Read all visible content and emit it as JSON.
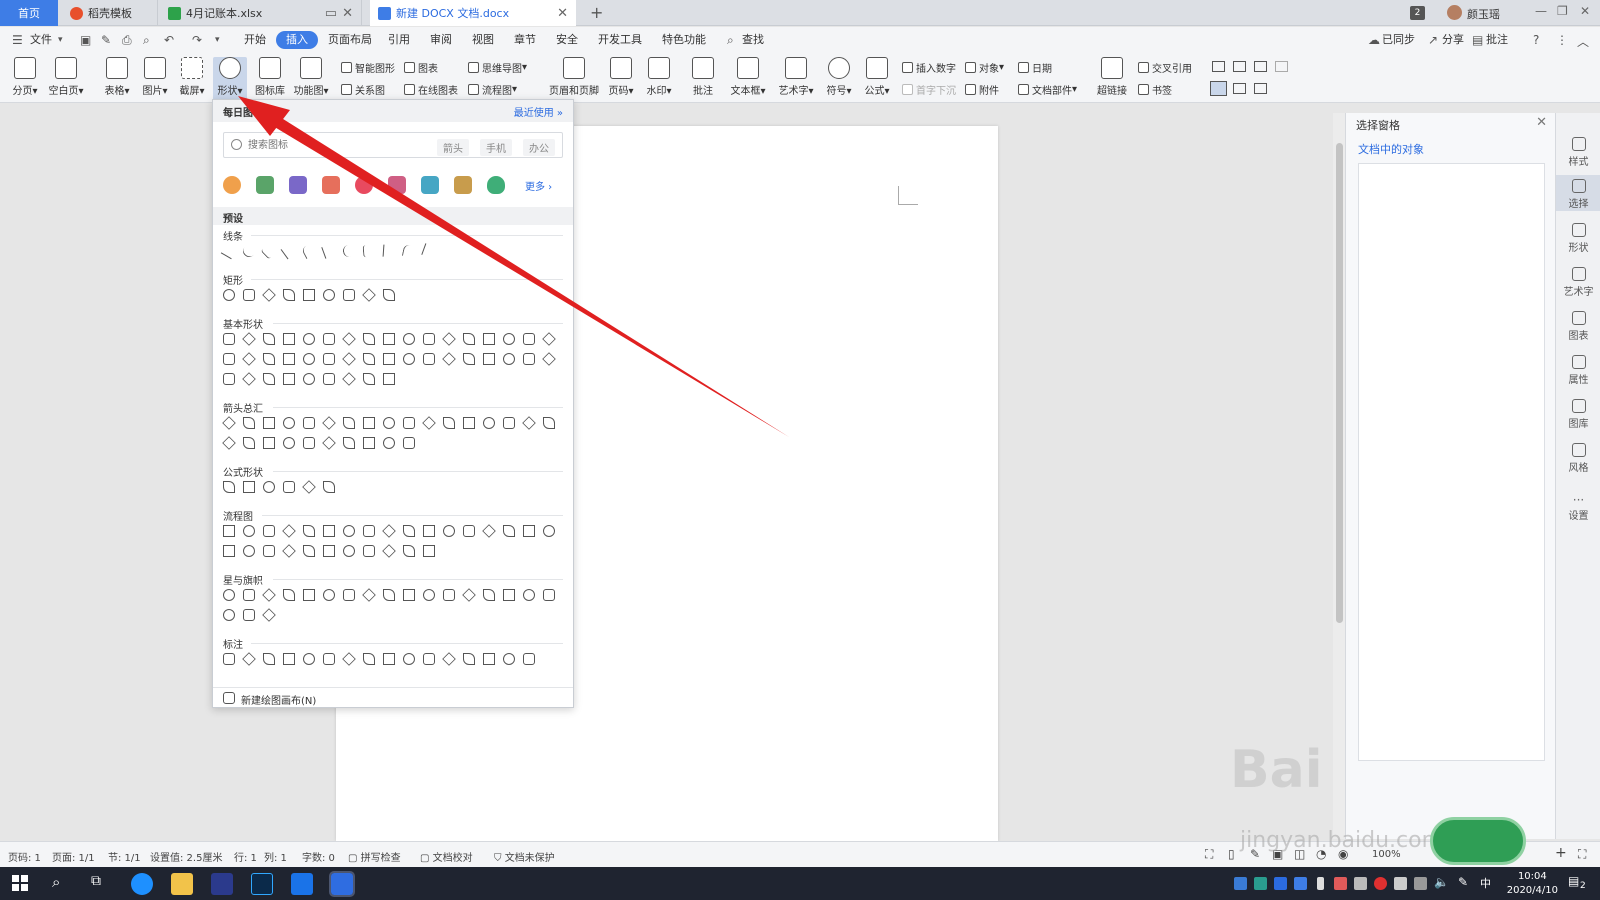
{
  "tabs": [
    {
      "label": "首页",
      "state": "home"
    },
    {
      "label": "稻壳模板",
      "state": "inactive"
    },
    {
      "label": "4月记账本.xlsx",
      "state": "inactive"
    },
    {
      "label": "新建 DOCX 文档.docx",
      "state": "active"
    }
  ],
  "tab_badge": "2",
  "user_name": "颜玉瑶",
  "menus": [
    "开始",
    "插入",
    "页面布局",
    "引用",
    "审阅",
    "视图",
    "章节",
    "安全",
    "开发工具",
    "特色功能"
  ],
  "menu_active": "插入",
  "file_menu": "文件",
  "search_label": "查找",
  "top_right": {
    "sync": "已同步",
    "share": "分享",
    "comment": "批注"
  },
  "ribbon": {
    "page_break": "分页",
    "blank_page": "空白页",
    "table": "表格",
    "picture": "图片",
    "screenshot": "截屏",
    "shapes": "形状",
    "icon_lib": "图标库",
    "function_chart": "功能图",
    "smart_art": "智能图形",
    "chart": "图表",
    "relation": "关系图",
    "online_chart": "在线图表",
    "mind_map": "思维导图",
    "flowchart": "流程图",
    "header_footer": "页眉和页脚",
    "page_number": "页码",
    "watermark": "水印",
    "comment": "批注",
    "textbox": "文本框",
    "wordart": "艺术字",
    "symbol": "符号",
    "formula": "公式",
    "insert_number": "插入数字",
    "object": "对象",
    "date": "日期",
    "drop_cap": "首字下沉",
    "attachment": "附件",
    "doc_parts": "文档部件",
    "hyperlink": "超链接",
    "cross_ref": "交叉引用",
    "bookmark": "书签"
  },
  "dropdown": {
    "header_left": "每日图标",
    "header_right": "最近使用",
    "search_placeholder": "搜索图标",
    "chips": [
      "箭头",
      "手机",
      "办公"
    ],
    "more": "更多",
    "preset": "预设",
    "categories": [
      {
        "name": "线条",
        "rows": [
          11
        ]
      },
      {
        "name": "矩形",
        "rows": [
          9
        ]
      },
      {
        "name": "基本形状",
        "rows": [
          17,
          17,
          9
        ]
      },
      {
        "name": "箭头总汇",
        "rows": [
          17,
          10
        ]
      },
      {
        "name": "公式形状",
        "rows": [
          6
        ]
      },
      {
        "name": "流程图",
        "rows": [
          17,
          11
        ]
      },
      {
        "name": "星与旗帜",
        "rows": [
          17,
          3
        ]
      },
      {
        "name": "标注",
        "rows": [
          16
        ]
      }
    ],
    "footer": "新建绘图画布(N)"
  },
  "selection_pane": {
    "title": "选择窗格",
    "subtitle": "文档中的对象"
  },
  "sidebar": [
    {
      "label": "样式"
    },
    {
      "label": "选择"
    },
    {
      "label": "形状"
    },
    {
      "label": "艺术字"
    },
    {
      "label": "图表"
    },
    {
      "label": "属性"
    },
    {
      "label": "图库"
    },
    {
      "label": "风格"
    },
    {
      "label": "设置"
    }
  ],
  "status": {
    "page_code": "页码: 1",
    "page": "页面: 1/1",
    "section": "节: 1/1",
    "setting": "设置值: 2.5厘米",
    "row": "行: 1",
    "col": "列: 1",
    "words": "字数: 0",
    "spell": "拼写检查",
    "proof": "文档校对",
    "protect": "文档未保护",
    "zoom": "100%"
  },
  "clock": {
    "time": "10:04",
    "date": "2020/4/10"
  },
  "tray_badge": "2",
  "watermark": {
    "text": "Bai",
    "sub": "jingyan.baidu.com"
  },
  "colors": {
    "accent": "#3e7de6",
    "arrow": "#e02020"
  }
}
